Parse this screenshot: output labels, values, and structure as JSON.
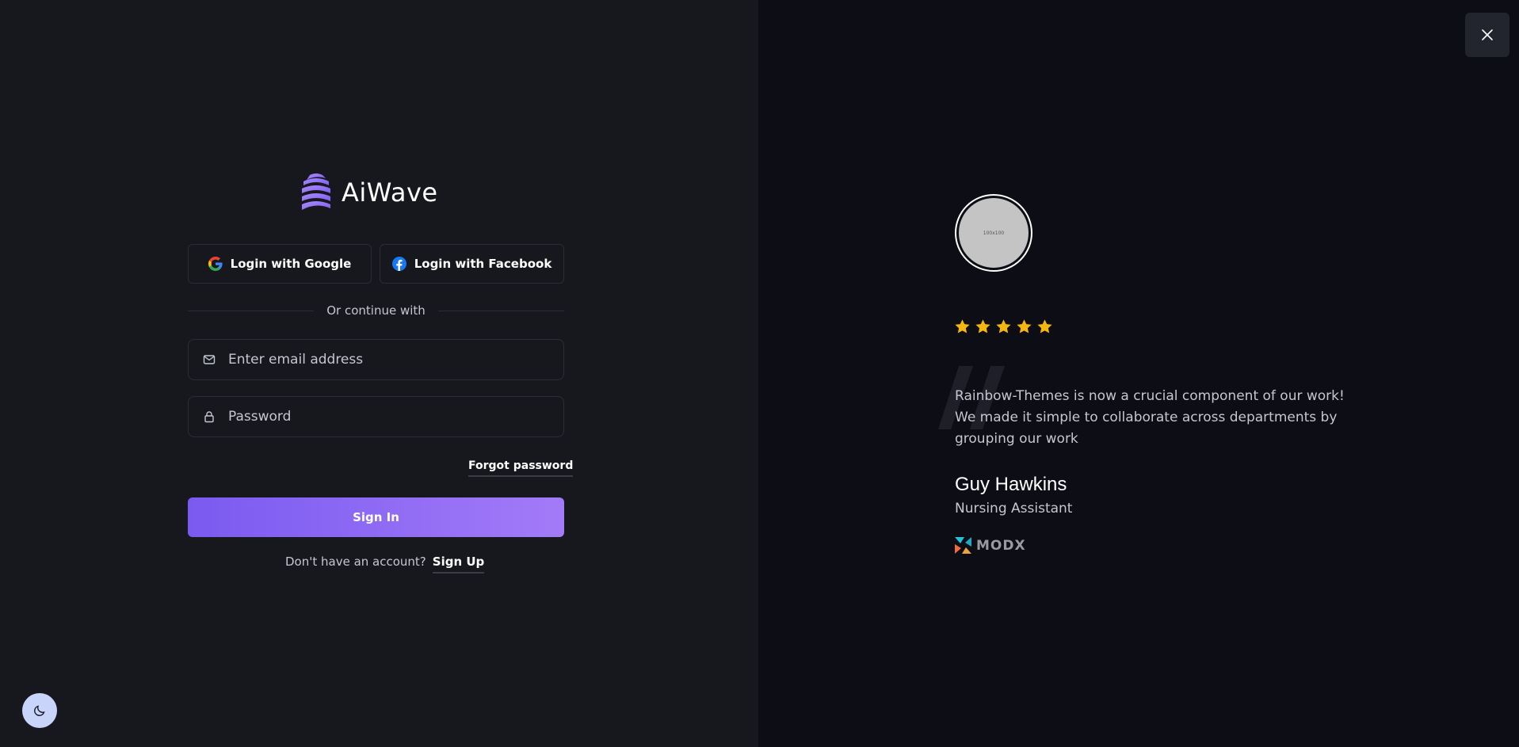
{
  "brand": {
    "name": "AiWave",
    "accent": "#8b6cf5"
  },
  "auth": {
    "google_label": "Login with Google",
    "facebook_label": "Login with Facebook",
    "divider_text": "Or continue with",
    "email_placeholder": "Enter email address",
    "password_placeholder": "Password",
    "forgot_label": "Forgot password",
    "signin_label": "Sign In",
    "signup_prompt": "Don't have an account?",
    "signup_label": "Sign Up"
  },
  "testimonial": {
    "avatar_placeholder": "100x100",
    "rating": 5,
    "rating_max": 5,
    "star_color": "#f5b70f",
    "text_lines": [
      "Rainbow-Themes is now a crucial component of our work!",
      "We made it simple to collaborate across departments by",
      "grouping our work"
    ],
    "name": "Guy Hawkins",
    "title": "Nursing Assistant",
    "company": "MODX"
  },
  "icons": {
    "close": "close-icon",
    "theme": "moon-icon",
    "email": "mail-icon",
    "password": "lock-icon",
    "google": "google-icon",
    "facebook": "facebook-icon"
  }
}
